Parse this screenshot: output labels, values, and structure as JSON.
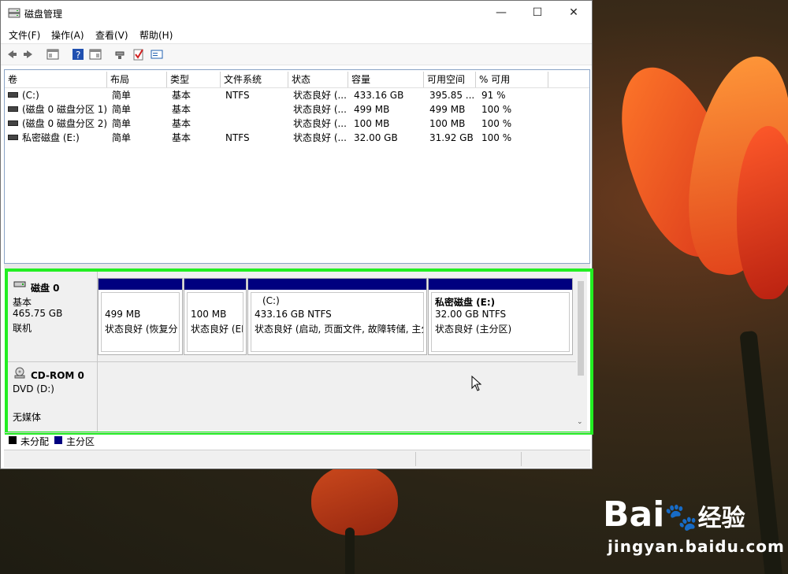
{
  "window": {
    "title": "磁盘管理",
    "minimize": "—",
    "maximize": "☐",
    "close": "✕"
  },
  "menu": [
    "文件(F)",
    "操作(A)",
    "查看(V)",
    "帮助(H)"
  ],
  "toolbar_icons": [
    "back-icon",
    "forward-icon",
    "console-tree-icon",
    "help-icon",
    "properties-icon",
    "connect-icon",
    "check-icon",
    "settings-icon"
  ],
  "volume_table": {
    "columns": [
      "卷",
      "布局",
      "类型",
      "文件系统",
      "状态",
      "容量",
      "可用空间",
      "% 可用"
    ],
    "rows": [
      [
        "(C:)",
        "简单",
        "基本",
        "NTFS",
        "状态良好 (...",
        "433.16 GB",
        "395.85 ...",
        "91 %"
      ],
      [
        "(磁盘 0 磁盘分区 1)",
        "简单",
        "基本",
        "",
        "状态良好 (...",
        "499 MB",
        "499 MB",
        "100 %"
      ],
      [
        "(磁盘 0 磁盘分区 2)",
        "简单",
        "基本",
        "",
        "状态良好 (...",
        "100 MB",
        "100 MB",
        "100 %"
      ],
      [
        "私密磁盘 (E:)",
        "简单",
        "基本",
        "NTFS",
        "状态良好 (...",
        "32.00 GB",
        "31.92 GB",
        "100 %"
      ]
    ]
  },
  "disk0": {
    "name": "磁盘 0",
    "type": "基本",
    "size": "465.75 GB",
    "status": "联机",
    "partitions": [
      {
        "title": "",
        "size": "499 MB",
        "status": "状态良好 (恢复分"
      },
      {
        "title": "",
        "size": "100 MB",
        "status": "状态良好 (EI"
      },
      {
        "title": "(C:)",
        "size": "433.16 GB NTFS",
        "status": "状态良好 (启动, 页面文件, 故障转储, 主分"
      },
      {
        "title": "私密磁盘  (E:)",
        "size": "32.00 GB NTFS",
        "status": "状态良好 (主分区)"
      }
    ]
  },
  "cdrom": {
    "name": "CD-ROM 0",
    "drive": "DVD (D:)",
    "media": "无媒体"
  },
  "legend": [
    {
      "label": "未分配",
      "color": "#000000"
    },
    {
      "label": "主分区",
      "color": "#00007f"
    }
  ],
  "colors": {
    "primary_partition": "#00007f",
    "highlight_border": "#22ee22"
  },
  "watermark": {
    "logo_text": "Bai",
    "logo_suffix": "经验",
    "url": "jingyan.baidu.com"
  }
}
